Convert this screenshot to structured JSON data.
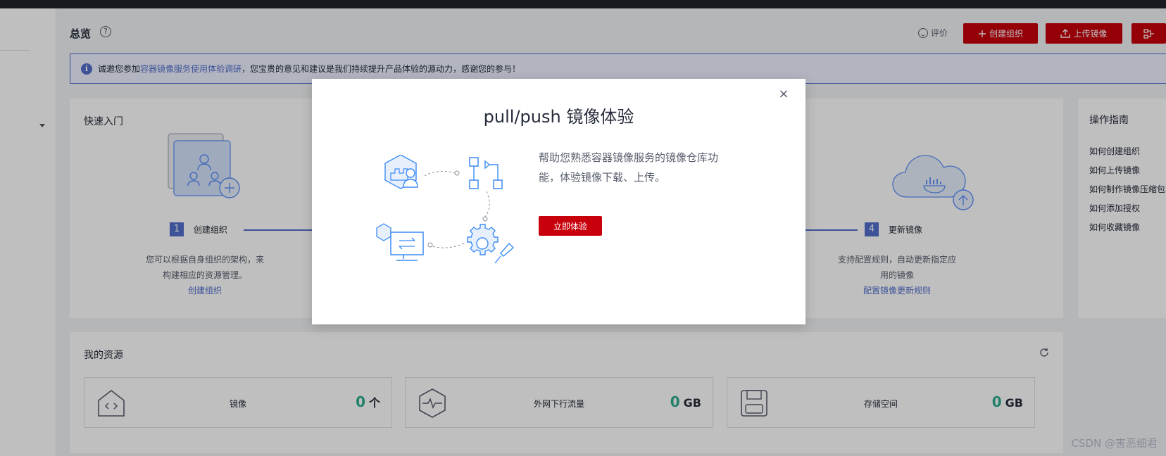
{
  "page": {
    "title": "总览",
    "help_icon": "?",
    "rate_label": "评价"
  },
  "toolbar": {
    "create_org_label": "创建组织",
    "upload_image_label": "上传镜像"
  },
  "notice": {
    "icon": "i",
    "prefix": "诚邀您参加",
    "link": "容器镜像服务使用体验调研",
    "suffix": "，您宝贵的意见和建议是我们持续提升产品体验的源动力，感谢您的参与！"
  },
  "quick_start": {
    "title": "快速入门",
    "steps": [
      {
        "number": "1",
        "label": "创建组织",
        "desc_line1": "您可以根据自身组织的架构，来",
        "desc_line2": "构建相应的资源管理。",
        "link": "创建组织"
      },
      {
        "number": "4",
        "label": "更新镜像",
        "desc_line1": "支持配置规则，自动更新指定应",
        "desc_line2": "用的镜像",
        "link": "配置镜像更新规则"
      }
    ]
  },
  "guide": {
    "title": "操作指南",
    "links": [
      "如何创建组织",
      "如何上传镜像",
      "如何制作镜像压缩包",
      "如何添加授权",
      "如何收藏镜像"
    ]
  },
  "resources": {
    "title": "我的资源",
    "items": [
      {
        "name": "镜像",
        "value": "0",
        "unit": "个"
      },
      {
        "name": "外网下行流量",
        "value": "0",
        "unit": "GB"
      },
      {
        "name": "存储空间",
        "value": "0",
        "unit": "GB"
      }
    ]
  },
  "modal": {
    "close": "×",
    "title": "pull/push 镜像体验",
    "desc": "帮助您熟悉容器镜像服务的镜像仓库功能，体验镜像下载、上传。",
    "button": "立即体验"
  },
  "watermark": "CSDN @害恶细君",
  "colors": {
    "brand_red": "#c7000b",
    "accent_blue": "#526ecc",
    "value_green": "#2cad8e"
  }
}
